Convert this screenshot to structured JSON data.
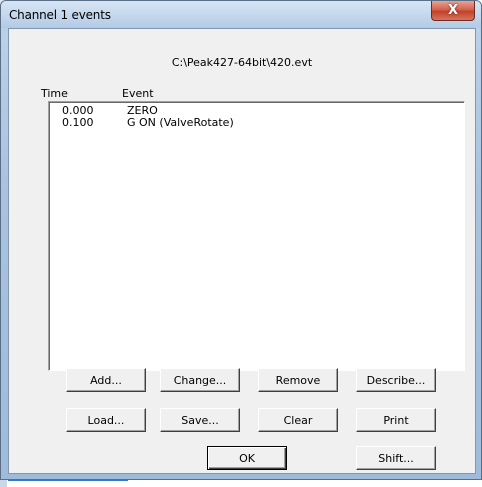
{
  "window": {
    "title": "Channel 1 events",
    "close_glyph": "X"
  },
  "file_path": "C:\\Peak427-64bit\\420.evt",
  "list": {
    "headers": {
      "time": "Time",
      "event": "Event"
    },
    "rows": [
      {
        "time": "0.000",
        "event": "ZERO"
      },
      {
        "time": "0.100",
        "event": "G ON (ValveRotate)"
      }
    ]
  },
  "buttons": {
    "add": "Add...",
    "change": "Change...",
    "remove": "Remove",
    "describe": "Describe...",
    "load": "Load...",
    "save": "Save...",
    "clear": "Clear",
    "print": "Print",
    "ok": "OK",
    "shift": "Shift..."
  },
  "colors": {
    "frame": "#a9c3df",
    "close_button": "#c2412a",
    "dialog_face": "#f0f0f0"
  }
}
